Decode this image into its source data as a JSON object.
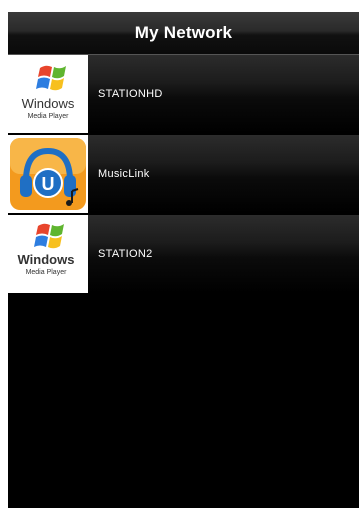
{
  "header": {
    "title": "My Network"
  },
  "devices": [
    {
      "name": "STATIONHD",
      "icon": "windows-media-player-icon",
      "logo_text": "Windows",
      "logo_subtext": "Media Player"
    },
    {
      "name": "MusicLink",
      "icon": "musiclink-headphones-icon",
      "logo_letter": "U"
    },
    {
      "name": "STATION2",
      "icon": "windows-media-player-icon",
      "logo_text": "Windows",
      "logo_subtext": "Media Player"
    }
  ],
  "colors": {
    "background": "#000000",
    "title_text": "#ffffff",
    "musiclink_orange": "#f39a1e",
    "musiclink_blue": "#1f6fc4"
  }
}
